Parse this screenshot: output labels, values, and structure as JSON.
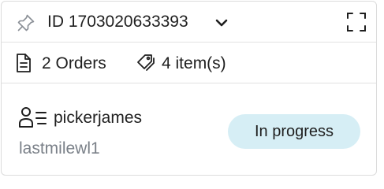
{
  "header": {
    "title": "ID 1703020633393",
    "icons": {
      "pin": "pin-icon",
      "dropdown": "chevron-down-icon",
      "expand": "expand-icon"
    }
  },
  "summary": {
    "orders_label": "2 Orders",
    "items_label": "4 item(s)",
    "icons": {
      "orders": "document-icon",
      "items": "tags-icon"
    }
  },
  "assignment": {
    "picker": "pickerjames",
    "location": "lastmilewl1",
    "status": "In progress",
    "icons": {
      "picker": "user-list-icon"
    }
  },
  "colors": {
    "status_bg": "#d6eef5",
    "secondary_text": "#7a8088",
    "divider": "#e2e2e2"
  }
}
